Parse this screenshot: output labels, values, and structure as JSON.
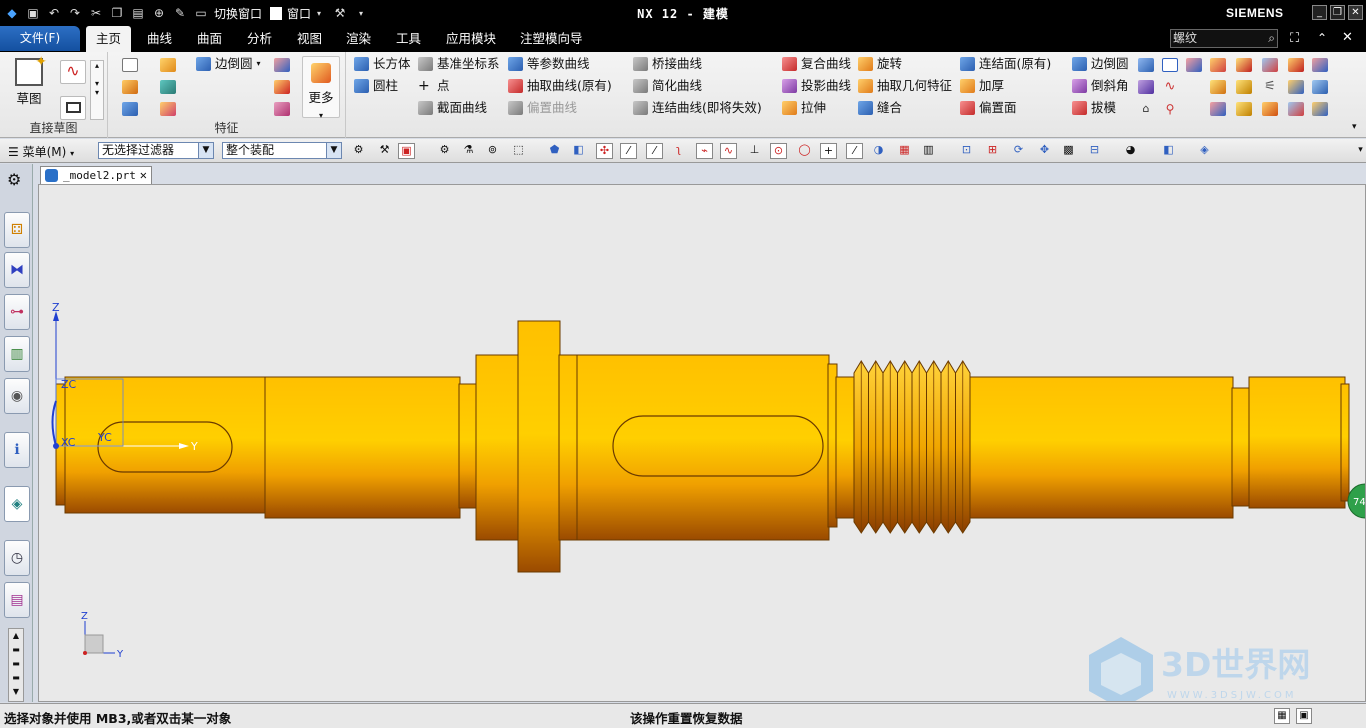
{
  "title_bar": {
    "title": "NX 12 - 建模",
    "brand": "SIEMENS",
    "switch_window_label": "切换窗口",
    "window_menu_label": "窗口"
  },
  "menu_tabs": {
    "file": "文件(F)",
    "tabs": [
      "主页",
      "曲线",
      "曲面",
      "分析",
      "视图",
      "渲染",
      "工具",
      "应用模块",
      "注塑模向导"
    ]
  },
  "search": {
    "value": "螺纹"
  },
  "ribbon": {
    "sketch_label": "草图",
    "direct_sketch_group": "直接草图",
    "feature_group": "特征",
    "more_label": "更多",
    "edge_blend_label": "边倒圆",
    "items": [
      "长方体",
      "圆柱",
      "基准坐标系",
      "点",
      "截面曲线",
      "等参数曲线",
      "抽取曲线(原有)",
      "偏置曲线",
      "桥接曲线",
      "简化曲线",
      "连结曲线(即将失效)",
      "复合曲线",
      "投影曲线",
      "拉伸",
      "旋转",
      "抽取几何特征",
      "缝合",
      "连结面(原有)",
      "加厚",
      "偏置面",
      "边倒圆",
      "倒斜角",
      "拔模"
    ]
  },
  "command_bar": {
    "menu_label": "菜单(M)",
    "filter_value": "无选择过滤器",
    "scope_value": "整个装配"
  },
  "document": {
    "tab_name": "_model2.prt"
  },
  "viewport": {
    "axes": {
      "z": "Z",
      "y": "Y",
      "zc": "ZC",
      "yc": "YC",
      "xc": "XC"
    },
    "part_color": "#f5a800",
    "badge_text": "74"
  },
  "status": {
    "left": "选择对象并使用 MB3,或者双击某一对象",
    "middle": "该操作重置恢复数据"
  },
  "watermark": {
    "text": "3D世界网",
    "url": "WWW.3DSJW.COM"
  }
}
